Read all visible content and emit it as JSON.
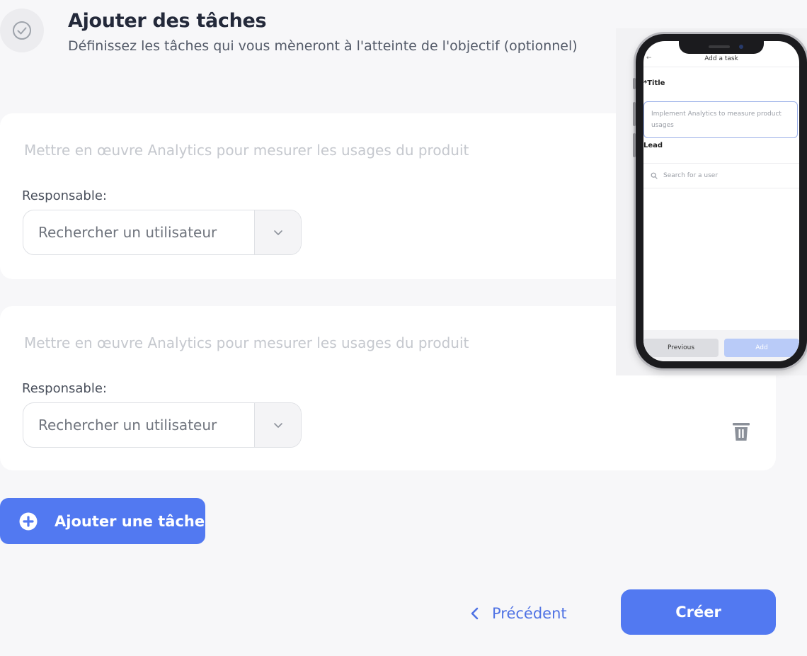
{
  "header": {
    "title": "Ajouter des tâches",
    "subtitle": "Définissez les tâches qui vous mèneront à l'atteinte de l'objectif (optionnel)"
  },
  "tasks": [
    {
      "title_placeholder": "Mettre en œuvre Analytics pour mesurer les usages du produit",
      "lead_label": "Responsable:",
      "lead_placeholder": "Rechercher un utilisateur"
    },
    {
      "title_placeholder": "Mettre en œuvre Analytics pour mesurer les usages du produit",
      "lead_label": "Responsable:",
      "lead_placeholder": "Rechercher un utilisateur"
    }
  ],
  "actions": {
    "add_task": "Ajouter une tâche",
    "previous": "Précédent",
    "create": "Créer"
  },
  "phone": {
    "header_title": "Add a task",
    "title_label": "*Title",
    "title_placeholder": "Implement Analytics to measure product usages",
    "lead_label": "Lead",
    "lead_placeholder": "Search for a user",
    "previous": "Previous",
    "add": "Add"
  },
  "colors": {
    "accent": "#5279f1",
    "background": "#f7f7f9",
    "card": "#ffffff"
  },
  "icons": [
    "check-circle-icon",
    "chevron-down-icon",
    "trash-icon",
    "plus-circle-icon",
    "chevron-left-icon",
    "search-icon"
  ]
}
